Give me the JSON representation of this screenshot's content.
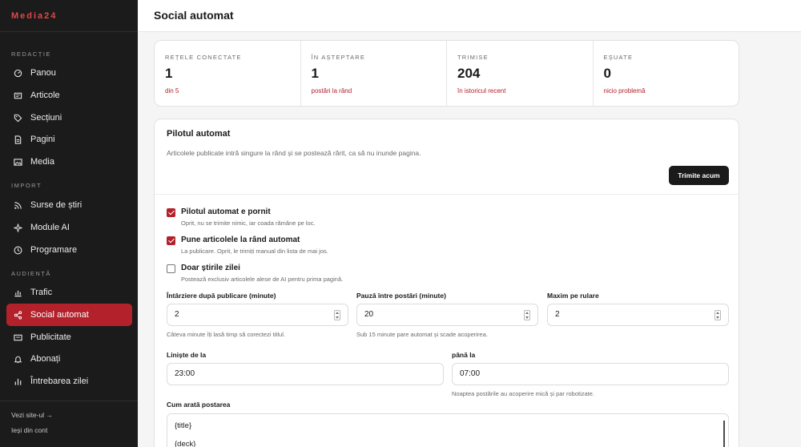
{
  "brand": "Media24",
  "sidebar": {
    "sections": [
      "REDACȚIE",
      "IMPORT",
      "AUDIENȚĂ"
    ],
    "items": [
      {
        "label": "Panou",
        "icon": "dashboard-icon"
      },
      {
        "label": "Articole",
        "icon": "article-icon"
      },
      {
        "label": "Secțiuni",
        "icon": "tag-icon"
      },
      {
        "label": "Pagini",
        "icon": "page-icon"
      },
      {
        "label": "Media",
        "icon": "image-icon"
      },
      {
        "label": "Surse de știri",
        "icon": "rss-icon"
      },
      {
        "label": "Module AI",
        "icon": "sparkle-icon"
      },
      {
        "label": "Programare",
        "icon": "clock-icon"
      },
      {
        "label": "Trafic",
        "icon": "chart-icon"
      },
      {
        "label": "Social automat",
        "icon": "share-icon"
      },
      {
        "label": "Publicitate",
        "icon": "ad-icon"
      },
      {
        "label": "Abonați",
        "icon": "bell-icon"
      },
      {
        "label": "Întrebarea zilei",
        "icon": "poll-icon"
      }
    ],
    "footer": {
      "visit": "Vezi site-ul →",
      "logout": "Ieși din cont"
    }
  },
  "header": {
    "title": "Social automat"
  },
  "stats": [
    {
      "label": "REȚELE CONECTATE",
      "value": "1",
      "sub": "din 5"
    },
    {
      "label": "ÎN AȘTEPTARE",
      "value": "1",
      "sub": "postări la rând"
    },
    {
      "label": "TRIMISE",
      "value": "204",
      "sub": "în istoricul recent"
    },
    {
      "label": "EȘUATE",
      "value": "0",
      "sub": "nicio problemă"
    }
  ],
  "autopilot": {
    "title": "Pilotul automat",
    "description": "Articolele publicate intră singure la rând și se postează rărit, ca să nu inunde pagina.",
    "send_now": "Trimite acum",
    "options": [
      {
        "label": "Pilotul automat e pornit",
        "help": "Oprit, nu se trimite nimic, iar coada rămâne pe loc.",
        "checked": true
      },
      {
        "label": "Pune articolele la rând automat",
        "help": "La publicare. Oprit, le trimiți manual din lista de mai jos.",
        "checked": true
      },
      {
        "label": "Doar știrile zilei",
        "help": "Postează exclusiv articolele alese de AI pentru prima pagină.",
        "checked": false
      }
    ],
    "fields": {
      "delay": {
        "label": "Întârziere după publicare (minute)",
        "value": "2",
        "help": "Câteva minute îți lasă timp să corectezi titlul."
      },
      "pause": {
        "label": "Pauză între postări (minute)",
        "value": "20",
        "help": "Sub 15 minute pare automat și scade acoperirea."
      },
      "max_per_run": {
        "label": "Maxim pe rulare",
        "value": "2"
      },
      "quiet_from": {
        "label": "Liniște de la",
        "value": "23:00"
      },
      "quiet_to": {
        "label": "până la",
        "value": "07:00",
        "help": "Noaptea postările au acoperire mică și par robotizate."
      },
      "template": {
        "label": "Cum arată postarea",
        "line1": "{title}",
        "line2": "{deck}"
      }
    }
  }
}
